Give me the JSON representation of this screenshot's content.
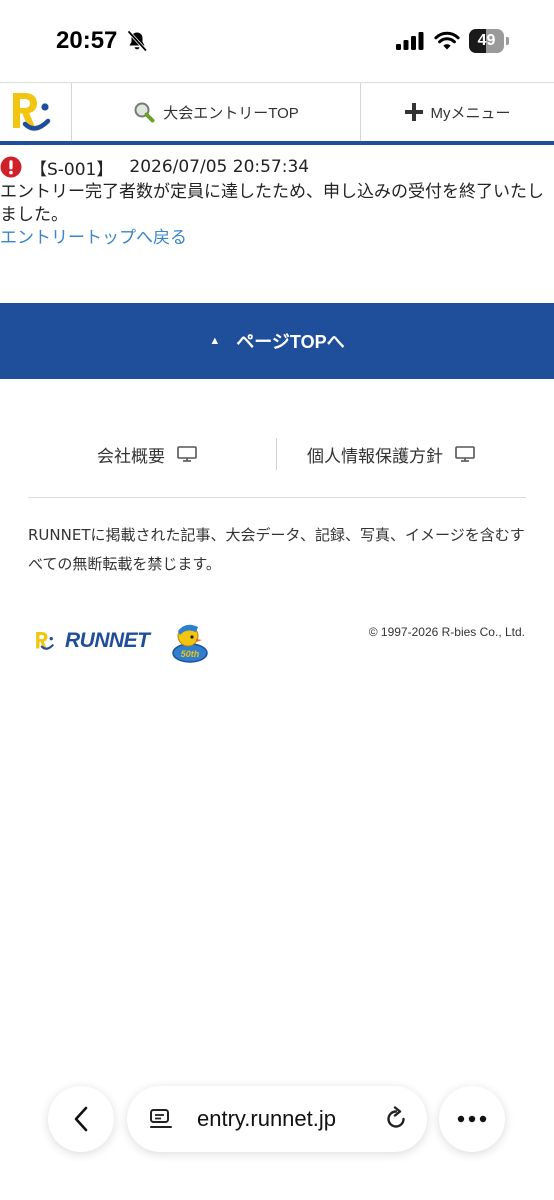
{
  "status_bar": {
    "time": "20:57",
    "battery_level": "49",
    "battery_fraction": 0.49
  },
  "header": {
    "logo": "R",
    "nav_items": [
      {
        "label": "大会エントリーTOP",
        "icon": "magnifier-icon"
      },
      {
        "label": "Myメニュー",
        "icon": "plus-icon"
      }
    ]
  },
  "error": {
    "code": "【S-001】",
    "timestamp": "2026/07/05 20:57:34",
    "message": "エントリー完了者数が定員に達したため、申し込みの受付を終了いたしました。",
    "link_text": "エントリートップへ戻る"
  },
  "page_top": {
    "arrow": "▲",
    "label": "ページTOPへ"
  },
  "footer": {
    "links": [
      {
        "label": "会社概要"
      },
      {
        "label": "個人情報保護方針"
      }
    ],
    "notice": "RUNNETに掲載された記事、大会データ、記録、写真、イメージを含むすべての無断転載を禁じます。",
    "logo_text": "RUNNET",
    "badge_text": "50th",
    "copyright": "© 1997-2026 R-bies Co., Ltd."
  },
  "browser": {
    "url": "entry.runnet.jp"
  },
  "colors": {
    "brand_blue": "#1f4e9b",
    "logo_yellow": "#f2c511",
    "link_blue": "#3a86c8",
    "error_red": "#d0202a"
  }
}
